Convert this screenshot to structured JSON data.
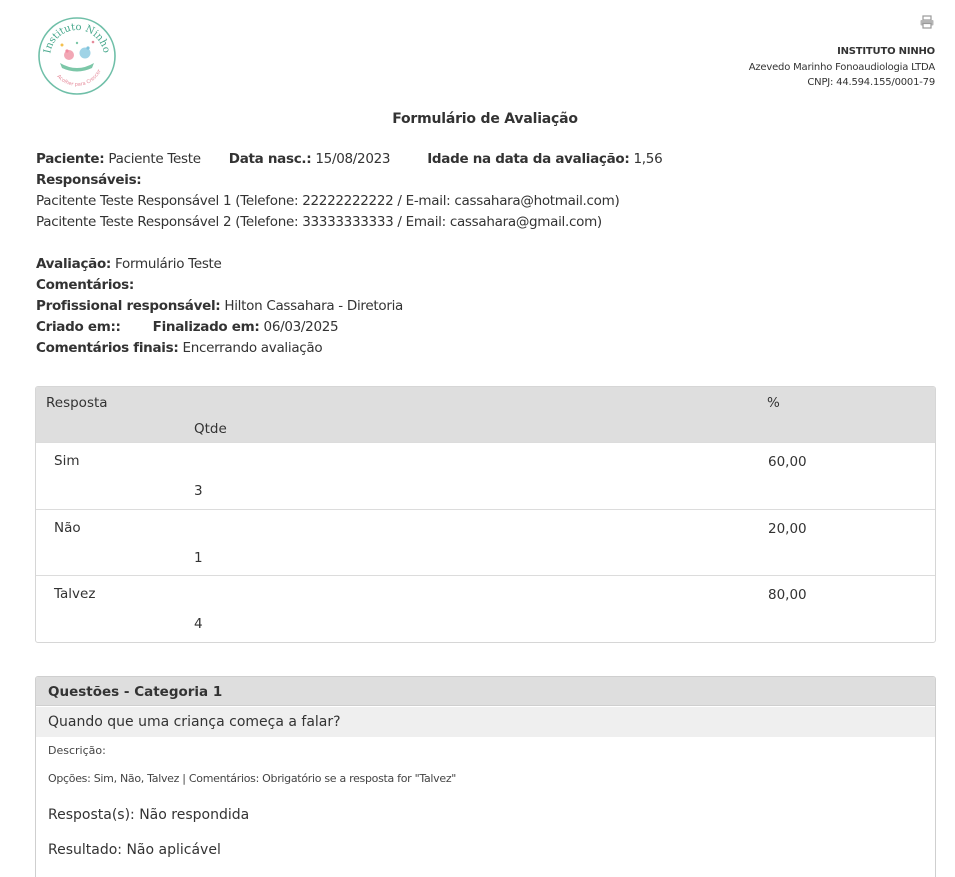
{
  "logo": {
    "name": "Instituto Ninho",
    "tagline": "Acolher para Crescer"
  },
  "header": {
    "company_name": "INSTITUTO NINHO",
    "company_legal": "Azevedo Marinho Fonoaudiologia LTDA",
    "cnpj": "CNPJ: 44.594.155/0001-79",
    "print_icon": "printer-icon"
  },
  "form_title": "Formulário de Avaliação",
  "patient": {
    "patient_label": "Paciente:",
    "patient_value": "Paciente Teste",
    "birth_label": "Data nasc.:",
    "birth_value": "15/08/2023",
    "age_label": "Idade na data da avaliação:",
    "age_value": "1,56",
    "responsaveis_label": "Responsáveis:",
    "responsaveis": [
      "Pacitente Teste Responsável 1 (Telefone: 22222222222 / E-mail: cassahara@hotmail.com)",
      "Pacitente Teste Responsável 2 (Telefone: 33333333333 / Email: cassahara@gmail.com)"
    ]
  },
  "evaluation": {
    "avaliacao_label": "Avaliação:",
    "avaliacao_value": "Formulário Teste",
    "comentarios_label": "Comentários:",
    "profissional_label": "Profissional responsável:",
    "profissional_value": "Hilton Cassahara - Diretoria",
    "criado_label": "Criado em::",
    "finalizado_label": "Finalizado em:",
    "finalizado_value": "06/03/2025",
    "comentarios_finais_label": "Comentários finais:",
    "comentarios_finais_value": "Encerrando avaliação"
  },
  "results_table": {
    "headers": {
      "resposta": "Resposta",
      "pct": "%",
      "qtde": "Qtde"
    },
    "rows": [
      {
        "label": "Sim",
        "pct": "60,00",
        "qtde": "3"
      },
      {
        "label": "Não",
        "pct": "20,00",
        "qtde": "1"
      },
      {
        "label": "Talvez",
        "pct": "80,00",
        "qtde": "4"
      }
    ]
  },
  "questions": {
    "category_title": "Questões - Categoria 1",
    "question": "Quando que uma criança começa a falar?",
    "descricao": "Descrição:",
    "opcoes": "Opções:  Sim, Não, Talvez | Comentários: Obrigatório se a resposta for \"Talvez\"",
    "resposta": "Resposta(s): Não respondida",
    "resultado": "Resultado: Não aplicável"
  }
}
